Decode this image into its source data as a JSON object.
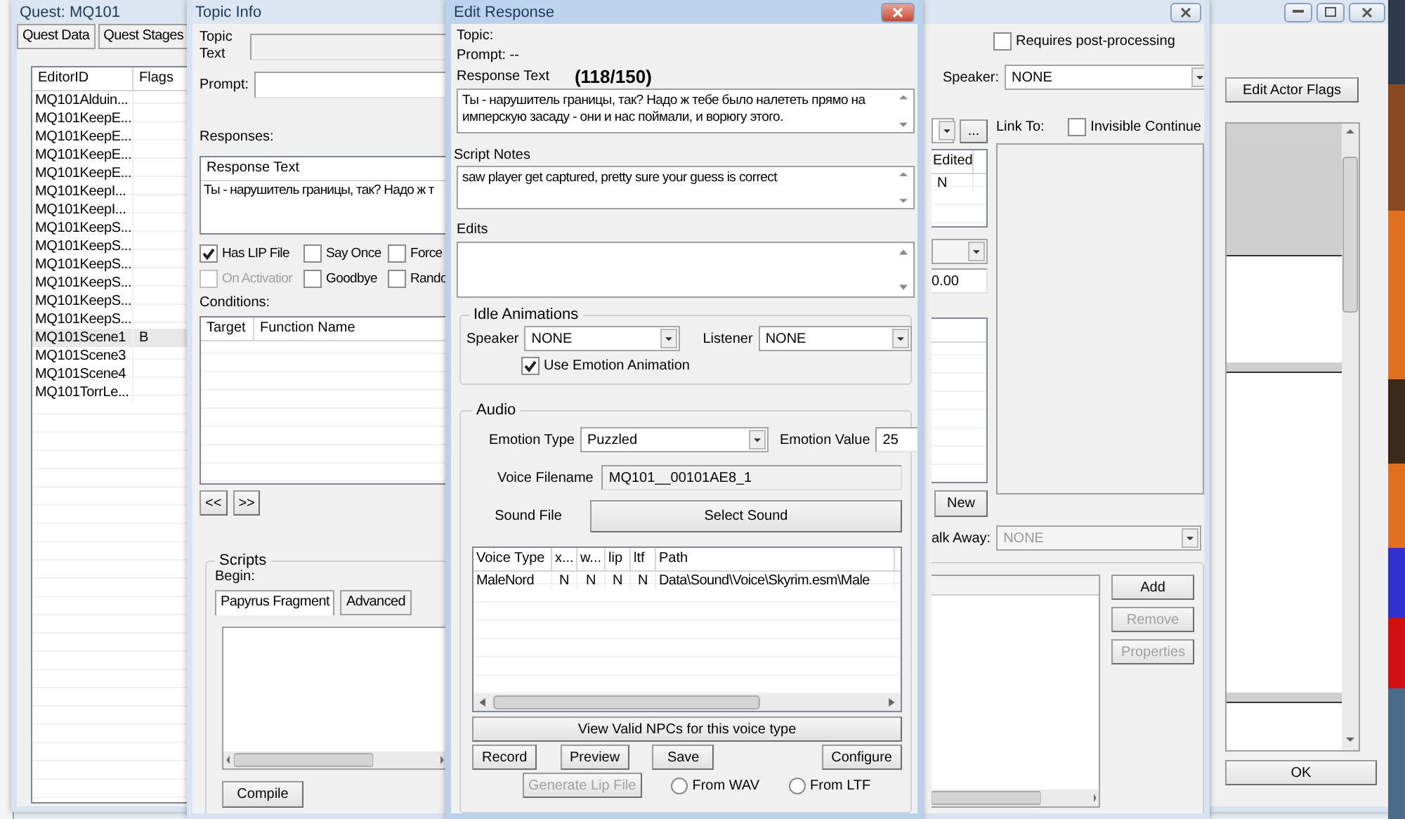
{
  "quest_window": {
    "title": "Quest: MQ101",
    "tabs": [
      {
        "label": "Quest Data",
        "selected": false
      },
      {
        "label": "Quest Stages",
        "selected": false
      }
    ],
    "topics": {
      "columns": [
        "EditorID",
        "Flags"
      ],
      "rows": [
        {
          "editor_id": "MQ101Alduin...",
          "selected": false
        },
        {
          "editor_id": "MQ101KeepE...",
          "selected": false
        },
        {
          "editor_id": "MQ101KeepE...",
          "selected": false
        },
        {
          "editor_id": "MQ101KeepE...",
          "selected": false
        },
        {
          "editor_id": "MQ101KeepE...",
          "selected": false
        },
        {
          "editor_id": "MQ101KeepI...",
          "selected": false
        },
        {
          "editor_id": "MQ101KeepI...",
          "selected": false
        },
        {
          "editor_id": "MQ101KeepS...",
          "selected": false
        },
        {
          "editor_id": "MQ101KeepS...",
          "selected": false
        },
        {
          "editor_id": "MQ101KeepS...",
          "selected": false
        },
        {
          "editor_id": "MQ101KeepS...",
          "selected": false
        },
        {
          "editor_id": "MQ101KeepS...",
          "selected": false
        },
        {
          "editor_id": "MQ101KeepS...",
          "selected": false
        },
        {
          "editor_id": "MQ101Scene1",
          "flags": "B",
          "selected": true
        },
        {
          "editor_id": "MQ101Scene3",
          "selected": false
        },
        {
          "editor_id": "MQ101Scene4",
          "selected": false
        },
        {
          "editor_id": "MQ101TorrLe...",
          "selected": false
        }
      ]
    },
    "actor_flags_button": "Edit Actor Flags",
    "ok_button": "OK"
  },
  "topic_info": {
    "title": "Topic Info",
    "topic_text_label": "Topic Text",
    "prompt_label": "Prompt:",
    "responses_label": "Responses:",
    "responses_table": {
      "column": "Response Text",
      "rows": [
        "Ты - нарушитель границы, так? Надо ж т"
      ]
    },
    "flags": [
      {
        "label": "Has LIP File",
        "checked": true,
        "disabled": false
      },
      {
        "label": "Say Once",
        "checked": false,
        "disabled": false
      },
      {
        "label": "Force",
        "checked": false,
        "disabled": false
      },
      {
        "label": "On Activatior",
        "checked": false,
        "disabled": true
      },
      {
        "label": "Goodbye",
        "checked": false,
        "disabled": false
      },
      {
        "label": "Rando",
        "checked": false,
        "disabled": false
      }
    ],
    "conditions_label": "Conditions:",
    "conditions_columns": [
      "Target",
      "Function Name"
    ],
    "nav_buttons": [
      "<<",
      ">>"
    ],
    "scripts": {
      "title": "Scripts",
      "begin_label": "Begin:",
      "tabs": [
        {
          "label": "Papyrus Fragment",
          "selected": true
        },
        {
          "label": "Advanced",
          "selected": false
        }
      ],
      "compile_button": "Compile"
    },
    "requires_post_processing": {
      "label": "Requires post-processing",
      "checked": false
    },
    "speaker": {
      "label": "Speaker:",
      "value": "NONE"
    },
    "more_button": "...",
    "link_to_label": "Link To:",
    "invisible_continue": {
      "label": "Invisible Continue",
      "checked": false
    },
    "responses_edited": {
      "column": "Edited",
      "value": "N"
    },
    "delay_value": "0.00",
    "new_button": "New",
    "walk_away": {
      "label": "alk Away:",
      "value": "NONE",
      "disabled": true
    },
    "action_buttons": [
      {
        "label": "Add",
        "disabled": false
      },
      {
        "label": "Remove",
        "disabled": true
      },
      {
        "label": "Properties",
        "disabled": true
      }
    ]
  },
  "edit_response": {
    "title": "Edit Response",
    "topic_label": "Topic:",
    "prompt_label": "Prompt: --",
    "response_text_label": "Response Text",
    "char_count": "(118/150)",
    "response_text": "Ты - нарушитель границы, так? Надо ж тебе было налететь прямо на имперскую засаду - они и нас поймали, и ворюгу этого.",
    "script_notes_label": "Script Notes",
    "script_notes": "saw player get captured, pretty sure your guess is correct",
    "edits_label": "Edits",
    "idle": {
      "title": "Idle Animations",
      "speaker_label": "Speaker",
      "speaker": "NONE",
      "listener_label": "Listener",
      "listener": "NONE",
      "use_emotion": {
        "label": "Use Emotion Animation",
        "checked": true
      }
    },
    "audio": {
      "title": "Audio",
      "emotion_type_label": "Emotion Type",
      "emotion_type": "Puzzled",
      "emotion_value_label": "Emotion Value",
      "emotion_value": "25",
      "voice_filename_label": "Voice Filename",
      "voice_filename": "MQ101__00101AE8_1",
      "sound_file_label": "Sound File",
      "select_sound_button": "Select Sound",
      "voice_table": {
        "columns": [
          "Voice Type",
          "x...",
          "w...",
          "lip",
          "ltf",
          "Path"
        ],
        "rows": [
          [
            "MaleNord",
            "N",
            "N",
            "N",
            "N",
            "Data\\Sound\\Voice\\Skyrim.esm\\Male"
          ]
        ]
      },
      "view_npcs_button": "View Valid NPCs for this voice type",
      "buttons": [
        "Record",
        "Preview",
        "Save",
        "Configure"
      ],
      "generate_lip": {
        "label": "Generate Lip File",
        "disabled": true
      },
      "sources": [
        {
          "label": "From WAV",
          "selected": false
        },
        {
          "label": "From LTF",
          "selected": false
        }
      ]
    }
  }
}
